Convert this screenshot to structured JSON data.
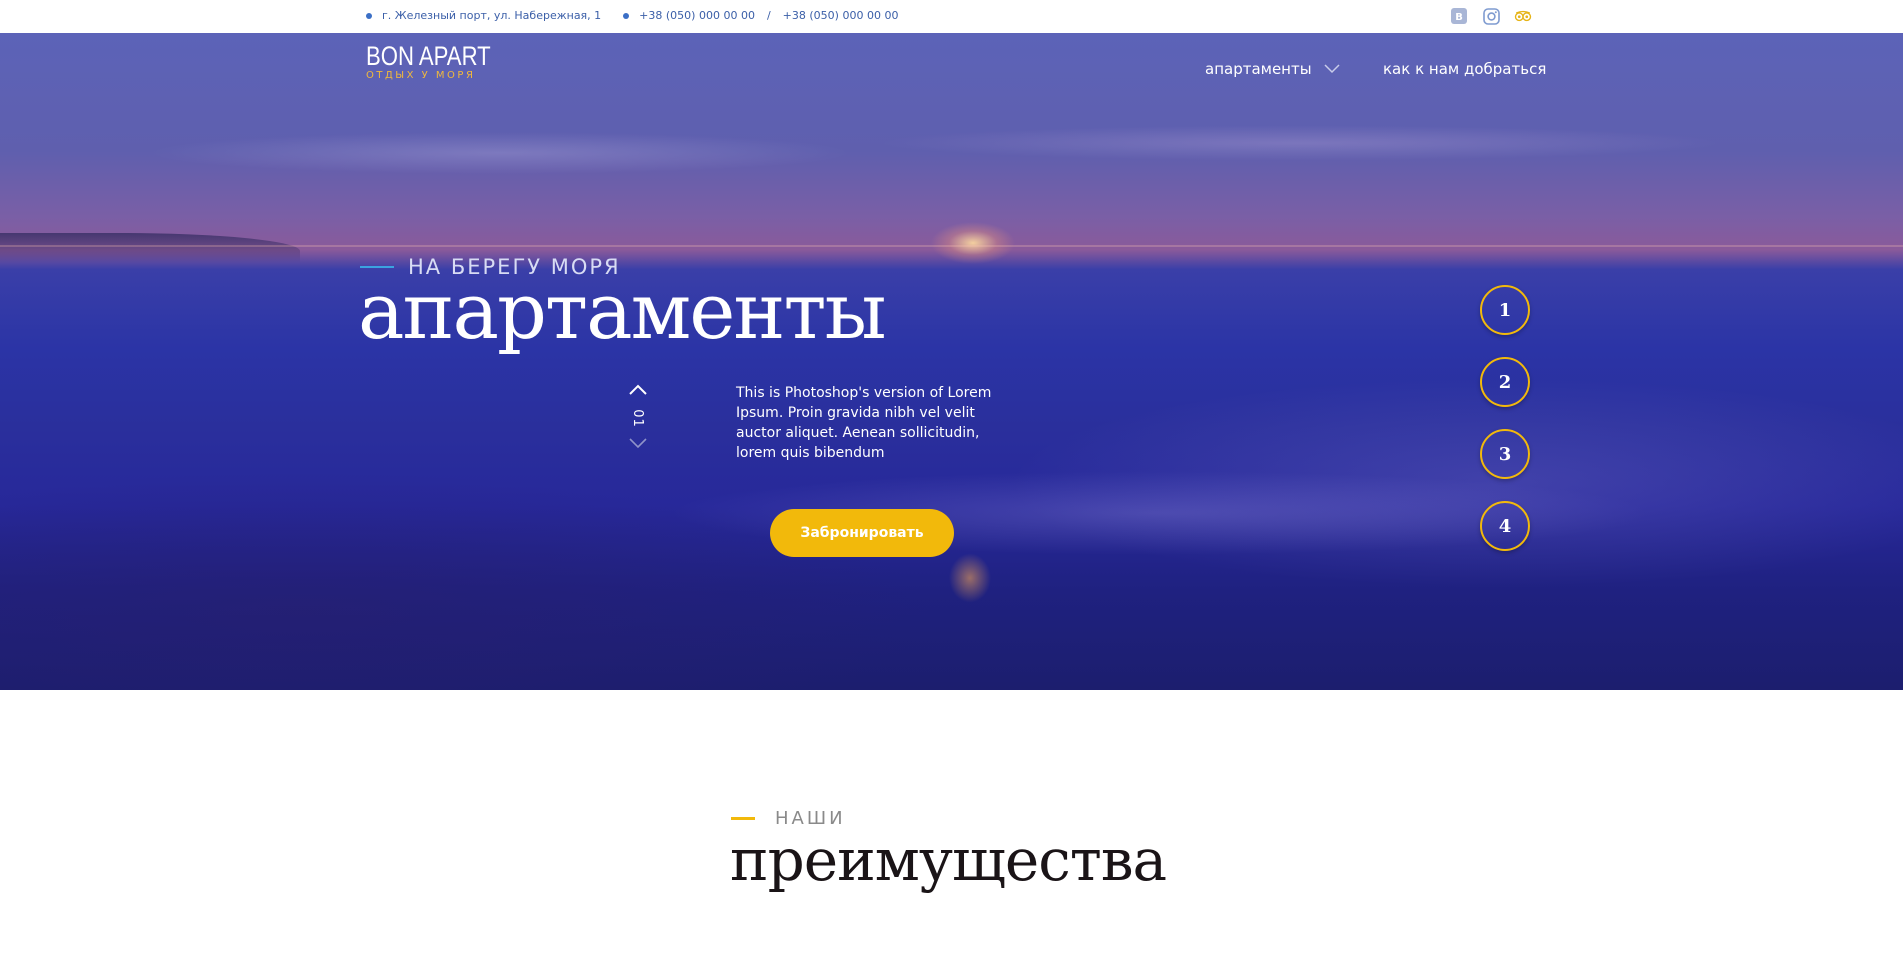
{
  "topbar": {
    "address": "г. Железный порт, ул. Набережная, 1",
    "phone1": "+38 (050) 000 00 00",
    "separator": "/",
    "phone2": "+38 (050) 000 00 00",
    "social": [
      "vk-icon",
      "instagram-icon",
      "tripadvisor-icon"
    ],
    "vk_label": "В"
  },
  "header": {
    "logo_title": "BON APART",
    "logo_subtitle": "ОТДЫХ У МОРЯ",
    "nav": {
      "apartments": "апартаменты",
      "directions": "как к нам добраться"
    }
  },
  "hero": {
    "kicker": "НА БЕРЕГУ МОРЯ",
    "title": "апартаменты",
    "slide_number": "01",
    "description": "This is Photoshop's version of Lorem Ipsum. Proin gravida nibh vel velit auctor aliquet. Aenean sollicitudin, lorem quis bibendum",
    "book_button": "Забронировать",
    "pager": [
      "1",
      "2",
      "3",
      "4"
    ]
  },
  "advantages": {
    "kicker": "НАШИ",
    "title": "преимущества"
  },
  "colors": {
    "accent": "#f2b90b",
    "kicker_line": "#3ba3e0",
    "topbar_text": "#3b5fa8"
  }
}
